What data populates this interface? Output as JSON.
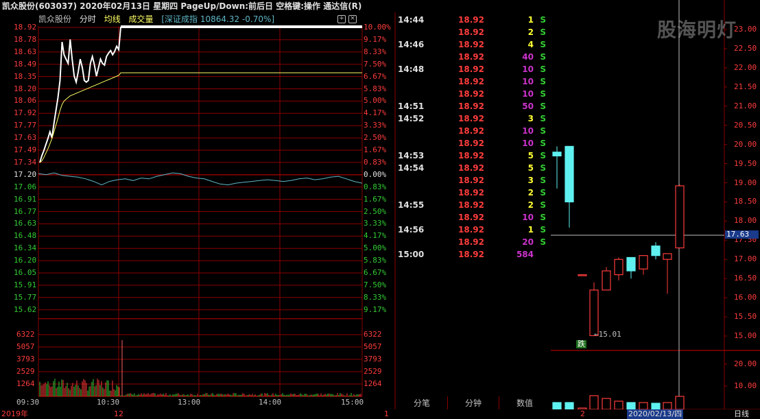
{
  "title": "凯众股份(603037)  2020年02月13日  星期四  PageUp/Down:前后日  空格键:操作  通达信(R)",
  "minute_header": {
    "stock": "凯众股份",
    "tab_minute": "分时",
    "tab_avg": "均线",
    "tab_volume": "成交量",
    "index_info": "[深证成指 10864.32 -0.70%]",
    "btn_add": "+",
    "btn_close": "×"
  },
  "watermark": "股海明灯",
  "colors": {
    "up": "#ff3c3c",
    "down": "#33cc33",
    "grid": "#8b0000",
    "price_line": "#ffffff",
    "avg_line": "#ffff66",
    "index_line": "#5fb7c7",
    "accent_purple": "#cc33cc",
    "accent_yellow": "#ffff33",
    "bear_candle": "#5ff0f0"
  },
  "price_axis_left": [
    "18.92",
    "18.78",
    "18.63",
    "18.49",
    "18.35",
    "18.20",
    "18.06",
    "17.92",
    "17.77",
    "17.63",
    "17.49",
    "17.34",
    "17.20",
    "17.06",
    "16.91",
    "16.77",
    "16.63",
    "16.48",
    "16.34",
    "16.20",
    "16.05",
    "15.91",
    "15.77",
    "15.62"
  ],
  "pct_axis_right": [
    "10.00%",
    "9.17%",
    "8.33%",
    "7.50%",
    "6.67%",
    "5.83%",
    "5.00%",
    "4.17%",
    "3.33%",
    "2.50%",
    "1.67%",
    "0.83%",
    "0.00%",
    "0.83%",
    "1.67%",
    "2.50%",
    "3.33%",
    "4.17%",
    "5.00%",
    "5.83%",
    "6.67%",
    "7.50%",
    "8.33%",
    "9.17%"
  ],
  "vol_axis": [
    "6322",
    "5057",
    "3793",
    "2529",
    "1264"
  ],
  "time_axis": [
    "09:30",
    "10:30",
    "13:00",
    "14:00",
    "15:00"
  ],
  "ticks": [
    {
      "time": "14:44",
      "price": "18.92",
      "vol": "1",
      "flag": "S",
      "vcolor": "#ffff33"
    },
    {
      "time": "",
      "price": "18.92",
      "vol": "2",
      "flag": "S",
      "vcolor": "#ffff33"
    },
    {
      "time": "14:46",
      "price": "18.92",
      "vol": "4",
      "flag": "S",
      "vcolor": "#ffff33"
    },
    {
      "time": "",
      "price": "18.92",
      "vol": "40",
      "flag": "S",
      "vcolor": "#cc33cc"
    },
    {
      "time": "14:48",
      "price": "18.92",
      "vol": "10",
      "flag": "S",
      "vcolor": "#cc33cc"
    },
    {
      "time": "",
      "price": "18.92",
      "vol": "10",
      "flag": "S",
      "vcolor": "#cc33cc"
    },
    {
      "time": "",
      "price": "18.92",
      "vol": "10",
      "flag": "S",
      "vcolor": "#cc33cc"
    },
    {
      "time": "14:51",
      "price": "18.92",
      "vol": "50",
      "flag": "S",
      "vcolor": "#cc33cc"
    },
    {
      "time": "14:52",
      "price": "18.92",
      "vol": "3",
      "flag": "S",
      "vcolor": "#ffff33"
    },
    {
      "time": "",
      "price": "18.92",
      "vol": "10",
      "flag": "S",
      "vcolor": "#cc33cc"
    },
    {
      "time": "",
      "price": "18.92",
      "vol": "10",
      "flag": "S",
      "vcolor": "#cc33cc"
    },
    {
      "time": "14:53",
      "price": "18.92",
      "vol": "5",
      "flag": "S",
      "vcolor": "#ffff33"
    },
    {
      "time": "14:54",
      "price": "18.92",
      "vol": "5",
      "flag": "S",
      "vcolor": "#ffff33"
    },
    {
      "time": "",
      "price": "18.92",
      "vol": "3",
      "flag": "S",
      "vcolor": "#ffff33"
    },
    {
      "time": "",
      "price": "18.92",
      "vol": "2",
      "flag": "S",
      "vcolor": "#ffff33"
    },
    {
      "time": "14:55",
      "price": "18.92",
      "vol": "2",
      "flag": "S",
      "vcolor": "#ffff33"
    },
    {
      "time": "",
      "price": "18.92",
      "vol": "10",
      "flag": "S",
      "vcolor": "#cc33cc"
    },
    {
      "time": "14:56",
      "price": "18.92",
      "vol": "1",
      "flag": "S",
      "vcolor": "#ffff33"
    },
    {
      "time": "",
      "price": "18.92",
      "vol": "20",
      "flag": "S",
      "vcolor": "#cc33cc"
    },
    {
      "time": "15:00",
      "price": "18.92",
      "vol": "584",
      "flag": "",
      "vcolor": "#cc33cc"
    }
  ],
  "tick_tabs": [
    "分笔",
    "分钟",
    "数值"
  ],
  "kline_axis": [
    "23.00",
    "22.50",
    "22.00",
    "21.50",
    "21.00",
    "20.50",
    "20.00",
    "19.50",
    "19.00",
    "18.50",
    "18.00",
    "17.50",
    "17.00",
    "16.50",
    "16.00",
    "15.50",
    "15.00"
  ],
  "kline_current": "17.63",
  "kline_low_note": "15.01",
  "kline_limit_badge": "跌",
  "kline_vol_axis": [
    "20.00",
    "10.00"
  ],
  "bottom": {
    "year": "2019年",
    "m1": "12",
    "m2": "1",
    "m3": "2",
    "date": "2020/02/13/四",
    "period": "日线"
  },
  "minute_price_series": [
    17.34,
    17.42,
    17.48,
    17.55,
    17.62,
    17.7,
    17.63,
    17.8,
    17.95,
    18.1,
    18.3,
    18.75,
    18.6,
    18.55,
    18.5,
    18.78,
    18.55,
    18.35,
    18.28,
    18.4,
    18.55,
    18.45,
    18.3,
    18.28,
    18.3,
    18.5,
    18.58,
    18.48,
    18.35,
    18.45,
    18.55,
    18.5,
    18.48,
    18.58,
    18.62,
    18.65,
    18.6,
    18.64,
    18.7,
    18.66,
    18.92
  ],
  "minute_avg_series": [
    17.34,
    17.36,
    17.4,
    17.45,
    17.5,
    17.56,
    17.62,
    17.7,
    17.78,
    17.86,
    17.95,
    18.02,
    18.06,
    18.08,
    18.1,
    18.12,
    18.13,
    18.14,
    18.15,
    18.16,
    18.17,
    18.18,
    18.19,
    18.2,
    18.21,
    18.22,
    18.23,
    18.24,
    18.25,
    18.26,
    18.27,
    18.28,
    18.29,
    18.3,
    18.31,
    18.32,
    18.33,
    18.34,
    18.35,
    18.36,
    18.39
  ],
  "index_series": [
    17.21,
    17.2,
    17.22,
    17.19,
    17.18,
    17.17,
    17.15,
    17.12,
    17.08,
    17.12,
    17.14,
    17.15,
    17.13,
    17.16,
    17.15,
    17.18,
    17.2,
    17.22,
    17.21,
    17.18,
    17.16,
    17.15,
    17.12,
    17.09,
    17.08,
    17.1,
    17.11,
    17.12,
    17.13,
    17.14,
    17.13,
    17.12,
    17.13,
    17.15,
    17.16,
    17.14,
    17.15,
    17.17,
    17.18,
    17.15,
    17.12,
    17.1
  ],
  "kline_candles": [
    {
      "o": 19.8,
      "h": 19.95,
      "l": 18.85,
      "c": 19.7
    },
    {
      "o": 19.95,
      "h": 19.95,
      "l": 17.83,
      "c": 18.5
    },
    {
      "o": 16.6,
      "h": 16.6,
      "l": 16.6,
      "c": 16.6
    },
    {
      "o": 15.01,
      "h": 16.4,
      "l": 15.01,
      "c": 16.2
    },
    {
      "o": 16.2,
      "h": 16.8,
      "l": 16.2,
      "c": 16.7
    },
    {
      "o": 16.6,
      "h": 17.05,
      "l": 16.45,
      "c": 17.0
    },
    {
      "o": 17.05,
      "h": 17.05,
      "l": 16.5,
      "c": 16.7
    },
    {
      "o": 16.75,
      "h": 17.1,
      "l": 16.6,
      "c": 17.1
    },
    {
      "o": 17.35,
      "h": 17.45,
      "l": 17.0,
      "c": 17.1
    },
    {
      "o": 17.0,
      "h": 17.15,
      "l": 16.1,
      "c": 17.15
    },
    {
      "o": 17.3,
      "h": 18.95,
      "l": 17.3,
      "c": 18.92
    }
  ]
}
